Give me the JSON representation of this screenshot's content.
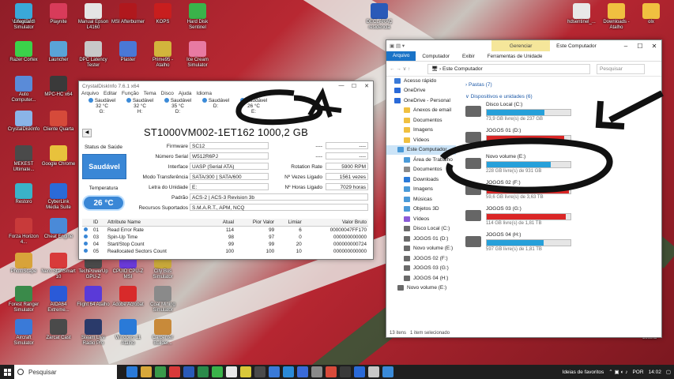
{
  "desktop": {
    "icons": [
      {
        "label": "VirtualDJ 8",
        "color": "#3a3a3a"
      },
      {
        "label": "Playnite",
        "color": "#d83b5a"
      },
      {
        "label": "Manual Epson L4160",
        "color": "#e5e5e5"
      },
      {
        "label": "MSI Afterburner",
        "color": "#b0181d"
      },
      {
        "label": "KOPS",
        "color": "#c81e1e"
      },
      {
        "label": "Hard Disk Sentinel",
        "color": "#3ab34a"
      },
      {
        "label": "Razer Cortex",
        "color": "#3bd14a"
      },
      {
        "label": "Launcher",
        "color": "#5aa3d8"
      },
      {
        "label": "DPC Latency Tester",
        "color": "#c8c8c8"
      },
      {
        "label": "Plaster",
        "color": "#4a78d6"
      },
      {
        "label": "Prime95 - Atalho",
        "color": "#d2b53c"
      },
      {
        "label": "Ice Cream Simulator",
        "color": "#e87aa2"
      },
      {
        "label": "Auto Computer...",
        "color": "#5a8bd8"
      },
      {
        "label": "MPC-HC x64",
        "color": "#3a3a3a"
      },
      {
        "label": "CrystalDiskInfo",
        "color": "#8ab4e8"
      },
      {
        "label": "Cliente Quarta",
        "color": "#d64a3a"
      },
      {
        "label": "MEKEST Ultimate...",
        "color": "#4a4a4a"
      },
      {
        "label": "Google Chrome",
        "color": "#e8c23c"
      },
      {
        "label": "Restoro",
        "color": "#3ab3c8"
      },
      {
        "label": "CyberLink Media Suite",
        "color": "#2a6ad8"
      },
      {
        "label": "Forza Horizon 4...",
        "color": "#c83a3a"
      },
      {
        "label": "Cheat Engine",
        "color": "#4a8ad8"
      },
      {
        "label": "PhotoScape",
        "color": "#d8a33a"
      },
      {
        "label": "Nero StartSmart 10",
        "color": "#d83a3a"
      },
      {
        "label": "TechPowerUp GPU-Z",
        "color": "#4a4a4a"
      },
      {
        "label": "CPUID CPU-Z MSI",
        "color": "#6a3ad8"
      },
      {
        "label": "City Bus Simulator",
        "color": "#c8a83a"
      },
      {
        "label": "Forest Ranger Simulator",
        "color": "#3a8a4a"
      },
      {
        "label": "AIDA64 Extreme...",
        "color": "#2a5ad8"
      },
      {
        "label": "Flight 64 Atalho",
        "color": "#5a3ad8"
      },
      {
        "label": "Adobe Acrobat",
        "color": "#d82a2a"
      },
      {
        "label": "Coal Mining Simulator",
        "color": "#8a8a8a"
      },
      {
        "label": "Aircraft Simulator",
        "color": "#3a7ad8"
      },
      {
        "label": "Zarcat Cast",
        "color": "#4a4a4a"
      },
      {
        "label": "Steam Live Radio Pro",
        "color": "#2a3a6a"
      },
      {
        "label": "Windows 11 Atalho",
        "color": "#2a7ad8"
      },
      {
        "label": "Carpenter Builder...",
        "color": "#c88a3a"
      },
      {
        "label": "Lifeguard Simulator",
        "color": "#3aa8d8"
      }
    ],
    "top_right_icons": [
      {
        "label": "DECLARAÇ residencia",
        "color": "#2a5ab8"
      },
      {
        "label": "hdsentinel_...",
        "color": "#e8e8e8"
      },
      {
        "label": "Downloads - Atalho",
        "color": "#f0c040"
      },
      {
        "label": "olx",
        "color": "#f0c040"
      }
    ],
    "bottom_right_icon": {
      "label": "Lixeira",
      "color": "#9a9a9a"
    }
  },
  "crystal": {
    "title": "CrystalDiskInfo 7.6.1 x64",
    "menu": [
      "Arquivo",
      "Editar",
      "Função",
      "Tema",
      "Disco",
      "Ajuda",
      "Idioma"
    ],
    "drives": [
      {
        "status": "Saudável",
        "temp": "32 °C",
        "letter": "G:"
      },
      {
        "status": "Saudável",
        "temp": "32 °C",
        "letter": "H:"
      },
      {
        "status": "Saudável",
        "temp": "35 °C",
        "letter": "D:"
      },
      {
        "status": "Saudável",
        "temp": "",
        "letter": "D:"
      },
      {
        "status": "Saudável",
        "temp": "26 °C",
        "letter": "E:"
      }
    ],
    "model": "ST1000VM002-1ET162 1000,2 GB",
    "status_label": "Status de Saúde",
    "status_value": "Saudável",
    "temp_label": "Temperatura",
    "temp_value": "26 °C",
    "fields": {
      "firmware_label": "Firmware",
      "firmware": "SC12",
      "serial_label": "Número Serial",
      "serial": "W512R6PJ",
      "interface_label": "Interface",
      "interface": "UASP (Serial ATA)",
      "transfer_label": "Modo Transferência",
      "transfer": "SATA/300 | SATA/600",
      "letter_label": "Letra do Unidade",
      "letter": "E:",
      "standard_label": "Padrão",
      "standard": "ACS-2 | ACS-3 Revision 3b",
      "features_label": "Recursos Suportados",
      "features": "S.M.A.R.T., APM, NCQ",
      "rotation_label": "Rotation Rate",
      "rotation": "5900 RPM",
      "power_count_label": "Nº Vezes Ligado",
      "power_count": "1561 vezes",
      "power_hours_label": "Nº Horas Ligado",
      "power_hours": "7029 horas",
      "blank1": "----",
      "blank2": "----"
    },
    "table": {
      "headers": [
        "ID",
        "Attribute Name",
        "Atual",
        "Pior Valor",
        "Limiar",
        "Valor Bruto"
      ],
      "rows": [
        [
          "01",
          "Read Error Rate",
          "114",
          "99",
          "6",
          "00000047FF170"
        ],
        [
          "03",
          "Spin-Up Time",
          "98",
          "97",
          "0",
          "000000000000"
        ],
        [
          "04",
          "Start/Stop Count",
          "99",
          "99",
          "20",
          "000000000724"
        ],
        [
          "05",
          "Reallocated Sectors Count",
          "100",
          "100",
          "10",
          "000000000000"
        ]
      ]
    }
  },
  "explorer": {
    "title": "Este Computador",
    "gerenciar": "Gerenciar",
    "ribbon": [
      "Arquivo",
      "Computador",
      "Exibir",
      "Ferramentas de Unidade"
    ],
    "path": "Este Computador",
    "search_placeholder": "Pesquisar",
    "nav": [
      {
        "label": "Acesso rápido",
        "color": "#3a7ad8"
      },
      {
        "label": "OneDrive",
        "color": "#2a6ad8"
      },
      {
        "label": "OneDrive - Personal",
        "color": "#2a6ad8"
      },
      {
        "label": "Anexos de email",
        "color": "#f0c040"
      },
      {
        "label": "Documentos",
        "color": "#f0c040"
      },
      {
        "label": "Imagens",
        "color": "#f0c040"
      },
      {
        "label": "Vídeos",
        "color": "#f0c040"
      },
      {
        "label": "Este Computador",
        "color": "#4a9ad8"
      },
      {
        "label": "Área de Trabalho",
        "color": "#4a9ad8"
      },
      {
        "label": "Documentos",
        "color": "#8a8a8a"
      },
      {
        "label": "Downloads",
        "color": "#2a7ad8"
      },
      {
        "label": "Imagens",
        "color": "#4a9ad8"
      },
      {
        "label": "Músicas",
        "color": "#4a9ad8"
      },
      {
        "label": "Objetos 3D",
        "color": "#4a9ad8"
      },
      {
        "label": "Vídeos",
        "color": "#8a5ad8"
      },
      {
        "label": "Disco Local (C:)",
        "color": "#6a6a6a"
      },
      {
        "label": "JOGOS 01 (D:)",
        "color": "#6a6a6a"
      },
      {
        "label": "Novo volume (E:)",
        "color": "#6a6a6a"
      },
      {
        "label": "JOGOS 02 (F:)",
        "color": "#6a6a6a"
      },
      {
        "label": "JOGOS 03 (G:)",
        "color": "#6a6a6a"
      },
      {
        "label": "JOGOS 04 (H:)",
        "color": "#6a6a6a"
      },
      {
        "label": "Novo volume (E:)",
        "color": "#6a6a6a"
      }
    ],
    "group_folders": "Pastas (7)",
    "group_drives": "Dispositivos e unidades (6)",
    "drives": [
      {
        "name": "Disco Local (C:)",
        "free": "73,9 GB livre(s) de 237 GB",
        "used": 0.69,
        "color": "#26a0da"
      },
      {
        "name": "JOGOS 01 (D:)",
        "free": "",
        "used": 0.92,
        "color": "#da2626"
      },
      {
        "name": "Novo volume (E:)",
        "free": "228 GB livre(s) de 931 GB",
        "used": 0.76,
        "color": "#26a0da"
      },
      {
        "name": "JOGOS 02 (F:)",
        "free": "59,6 GB livre(s) de 3,63 TB",
        "used": 0.98,
        "color": "#da2626"
      },
      {
        "name": "JOGOS 03 (G:)",
        "free": "114 GB livre(s) de 1,81 TB",
        "used": 0.94,
        "color": "#da2626"
      },
      {
        "name": "JOGOS 04 (H:)",
        "free": "597 GB livre(s) de 1,81 TB",
        "used": 0.68,
        "color": "#26a0da"
      }
    ],
    "status_count": "13 itens",
    "status_selected": "1 item selecionado"
  },
  "taskbar": {
    "search_placeholder": "Pesquisar",
    "apps": [
      "#2a7ad8",
      "#d8a83a",
      "#3a9a4a",
      "#d83a3a",
      "#2a5ab8",
      "#2a8a4a",
      "#3ab34a",
      "#e8e8e8",
      "#d8c83a",
      "#4a4a4a",
      "#3a7ad8",
      "#2a8ad8",
      "#3a6ad8",
      "#8a8a8a",
      "#d84a3a",
      "#3a3a3a",
      "#2a6ad8",
      "#c8c8c8",
      "#3a8ad8"
    ],
    "weather": "Ideias de favoritos",
    "lang": "POR",
    "time": "14:02"
  }
}
